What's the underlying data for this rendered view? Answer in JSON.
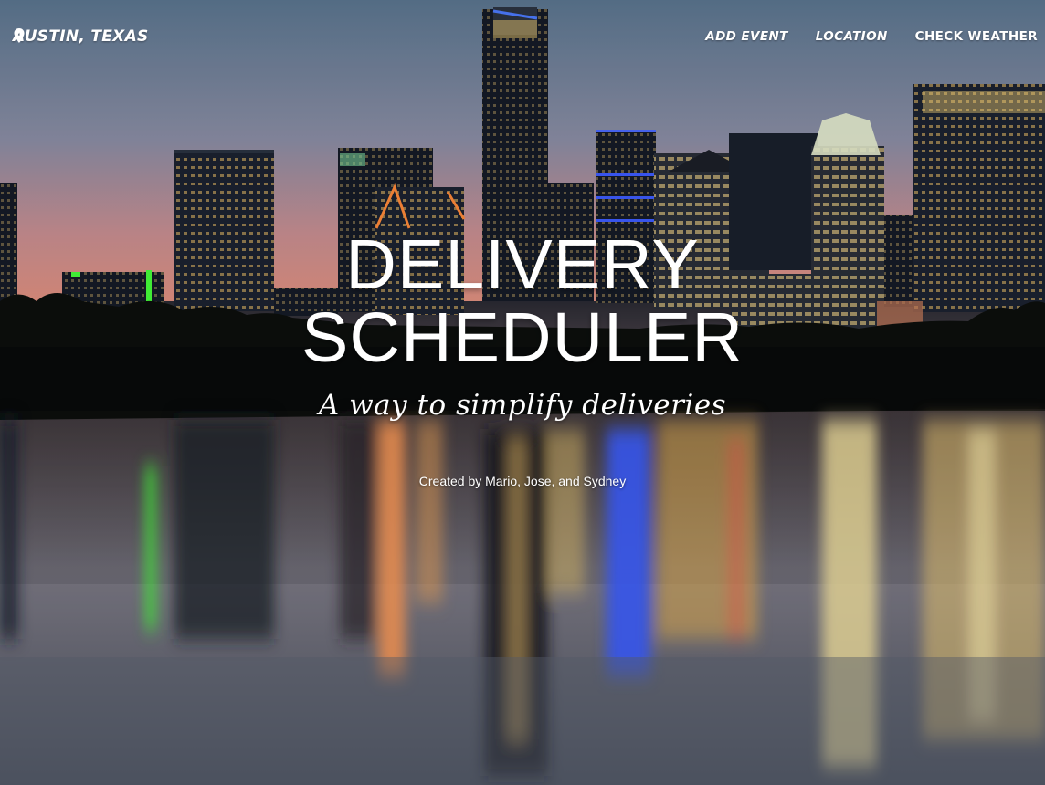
{
  "navbar": {
    "brand": {
      "icon": "map-pin-icon",
      "label": "AUSTIN, TEXAS"
    },
    "links": [
      {
        "label": "ADD EVENT"
      },
      {
        "label": "LOCATION"
      },
      {
        "label": "CHECK WEATHER"
      }
    ]
  },
  "hero": {
    "title_line1": "DELIVERY",
    "title_line2": "SCHEDULER",
    "tagline": "A way to simplify deliveries",
    "credits": "Created by Mario, Jose, and Sydney",
    "background": "austin-skyline-night-reflection-photo"
  },
  "colors": {
    "sky_top": "#5f7891",
    "sky_horizon": "#d98f84",
    "water": "#5b6370",
    "text": "#ffffff",
    "accent_green": "#46ff3a",
    "accent_blue": "#3a5cff",
    "accent_orange": "#ff8a3a"
  }
}
